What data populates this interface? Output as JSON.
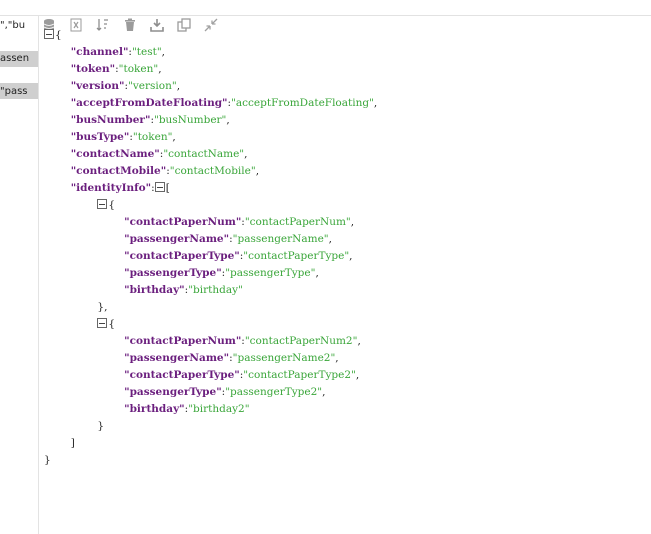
{
  "left_panel": {
    "lines": [
      "\",\"bu",
      "assen",
      "\"pass"
    ]
  },
  "toolbar": {
    "icons": [
      "database-icon",
      "clear-icon",
      "sort-icon",
      "delete-icon",
      "download-icon",
      "copy-icon",
      "collapse-icon"
    ]
  },
  "json": {
    "open": "{",
    "close": "}",
    "pairs": [
      {
        "key": "\"channel\"",
        "value": "\"test\""
      },
      {
        "key": "\"token\"",
        "value": "\"token\""
      },
      {
        "key": "\"version\"",
        "value": "\"version\""
      },
      {
        "key": "\"acceptFromDateFloating\"",
        "value": "\"acceptFromDateFloating\""
      },
      {
        "key": "\"busNumber\"",
        "value": "\"busNumber\""
      },
      {
        "key": "\"busType\"",
        "value": "\"token\""
      },
      {
        "key": "\"contactName\"",
        "value": "\"contactName\""
      },
      {
        "key": "\"contactMobile\"",
        "value": "\"contactMobile\""
      }
    ],
    "identity_key": "\"identityInfo\"",
    "array_open": "[",
    "array_close": "]",
    "items": [
      {
        "pairs": [
          {
            "key": "\"contactPaperNum\"",
            "value": "\"contactPaperNum\""
          },
          {
            "key": "\"passengerName\"",
            "value": "\"passengerName\""
          },
          {
            "key": "\"contactPaperType\"",
            "value": "\"contactPaperType\""
          },
          {
            "key": "\"passengerType\"",
            "value": "\"passengerType\""
          },
          {
            "key": "\"birthday\"",
            "value": "\"birthday\""
          }
        ],
        "close": "},"
      },
      {
        "pairs": [
          {
            "key": "\"contactPaperNum\"",
            "value": "\"contactPaperNum2\""
          },
          {
            "key": "\"passengerName\"",
            "value": "\"passengerName2\""
          },
          {
            "key": "\"contactPaperType\"",
            "value": "\"contactPaperType2\""
          },
          {
            "key": "\"passengerType\"",
            "value": "\"passengerType2\""
          },
          {
            "key": "\"birthday\"",
            "value": "\"birthday2\""
          }
        ],
        "close": "}"
      }
    ]
  }
}
